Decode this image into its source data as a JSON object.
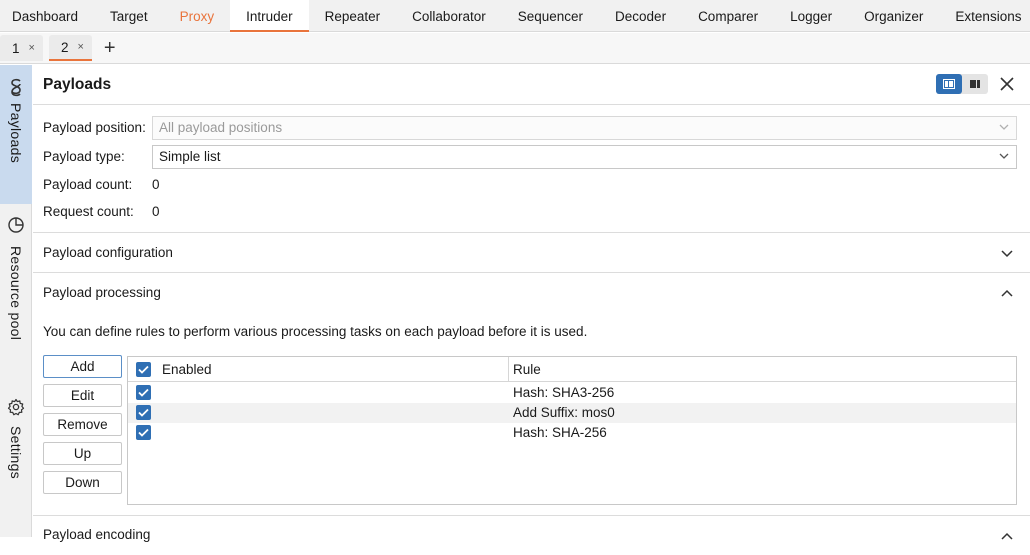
{
  "top_tabs": [
    {
      "label": "Dashboard"
    },
    {
      "label": "Target"
    },
    {
      "label": "Proxy"
    },
    {
      "label": "Intruder"
    },
    {
      "label": "Repeater"
    },
    {
      "label": "Collaborator"
    },
    {
      "label": "Sequencer"
    },
    {
      "label": "Decoder"
    },
    {
      "label": "Comparer"
    },
    {
      "label": "Logger"
    },
    {
      "label": "Organizer"
    },
    {
      "label": "Extensions"
    }
  ],
  "active_top_tab": "Intruder",
  "sub_tabs": [
    {
      "label": "1",
      "close": "×"
    },
    {
      "label": "2",
      "close": "×"
    }
  ],
  "new_tab_label": "+",
  "side_tabs": [
    {
      "label": "Payloads",
      "icon": "payloads-icon"
    },
    {
      "label": "Resource pool",
      "icon": "resource-pool-icon"
    },
    {
      "label": "Settings",
      "icon": "gear-icon"
    }
  ],
  "panel": {
    "title": "Payloads",
    "payload_position_label": "Payload position:",
    "payload_position_value": "All payload positions",
    "payload_type_label": "Payload type:",
    "payload_type_value": "Simple list",
    "payload_count_label": "Payload count:",
    "payload_count_value": "0",
    "request_count_label": "Request count:",
    "request_count_value": "0"
  },
  "sections": {
    "configuration": "Payload configuration",
    "processing": "Payload processing",
    "encoding": "Payload encoding"
  },
  "processing": {
    "description": "You can define rules to perform various processing tasks on each payload before it is used.",
    "buttons": {
      "add": "Add",
      "edit": "Edit",
      "remove": "Remove",
      "up": "Up",
      "down": "Down"
    },
    "columns": {
      "enabled": "Enabled",
      "rule": "Rule"
    },
    "rules": [
      {
        "enabled": true,
        "rule": "Hash: SHA3-256"
      },
      {
        "enabled": true,
        "rule": "Add Suffix: mos0"
      },
      {
        "enabled": true,
        "rule": "Hash: SHA-256"
      }
    ]
  },
  "colors": {
    "accent": "#e9743c",
    "selection": "#2f6fb4",
    "side_active": "#c9daee"
  }
}
